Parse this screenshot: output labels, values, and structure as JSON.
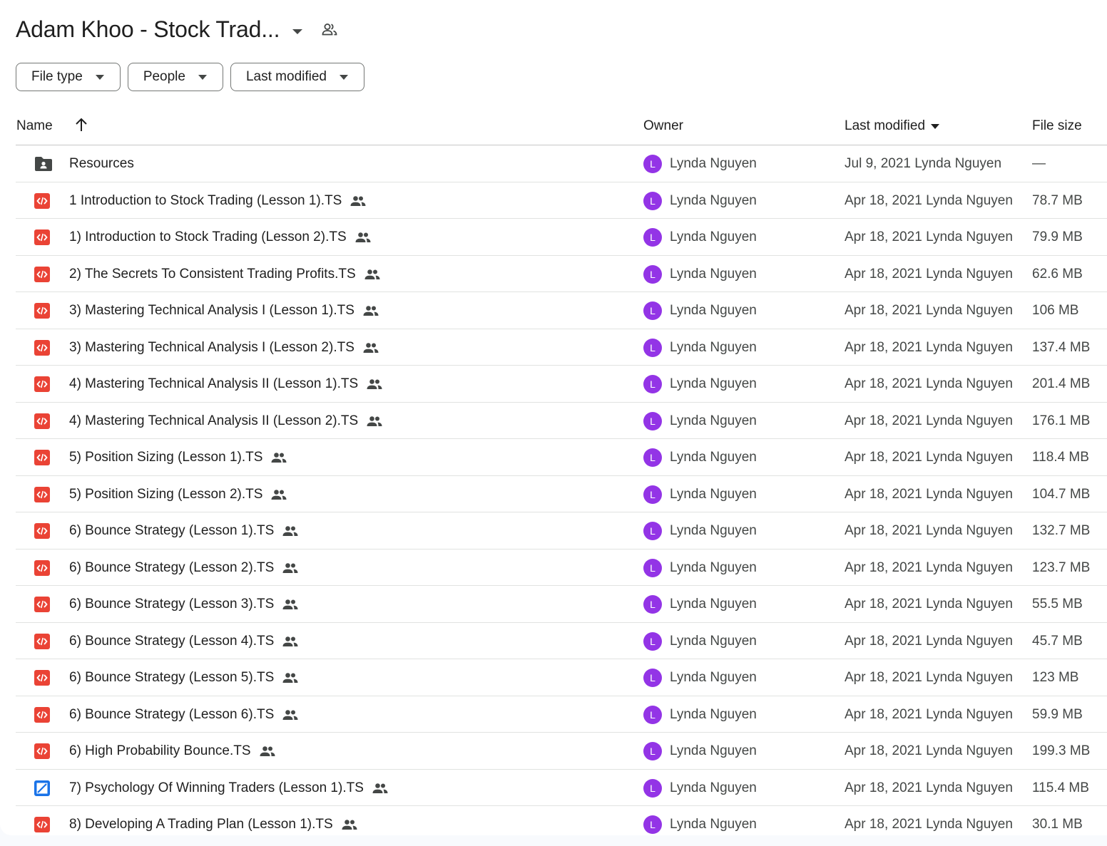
{
  "folder": {
    "title": "Adam Khoo - Stock Trad...",
    "caret_icon": "arrow-drop-down-icon",
    "share_icon": "people-outline-icon"
  },
  "filters": [
    {
      "label": "File type"
    },
    {
      "label": "People"
    },
    {
      "label": "Last modified"
    }
  ],
  "columns": {
    "name": "Name",
    "owner": "Owner",
    "last_modified": "Last modified",
    "file_size": "File size"
  },
  "colors": {
    "avatar": "#9334e6",
    "file_icon": "#ea4335",
    "folder_icon": "#444746",
    "video_icon": "#1a73e8"
  },
  "rows": [
    {
      "name": "Resources",
      "type": "folder",
      "shared": false,
      "owner_initial": "L",
      "owner": "Lynda Nguyen",
      "modified": "Jul 9, 2021 Lynda Nguyen",
      "size": "—"
    },
    {
      "name": "1 Introduction to Stock Trading (Lesson 1).TS",
      "type": "code",
      "shared": true,
      "owner_initial": "L",
      "owner": "Lynda Nguyen",
      "modified": "Apr 18, 2021 Lynda Nguyen",
      "size": "78.7 MB"
    },
    {
      "name": "1) Introduction to Stock Trading (Lesson 2).TS",
      "type": "code",
      "shared": true,
      "owner_initial": "L",
      "owner": "Lynda Nguyen",
      "modified": "Apr 18, 2021 Lynda Nguyen",
      "size": "79.9 MB"
    },
    {
      "name": "2) The Secrets To Consistent Trading Profits.TS",
      "type": "code",
      "shared": true,
      "owner_initial": "L",
      "owner": "Lynda Nguyen",
      "modified": "Apr 18, 2021 Lynda Nguyen",
      "size": "62.6 MB"
    },
    {
      "name": "3) Mastering Technical Analysis I (Lesson 1).TS",
      "type": "code",
      "shared": true,
      "owner_initial": "L",
      "owner": "Lynda Nguyen",
      "modified": "Apr 18, 2021 Lynda Nguyen",
      "size": "106 MB"
    },
    {
      "name": "3) Mastering Technical Analysis I (Lesson 2).TS",
      "type": "code",
      "shared": true,
      "owner_initial": "L",
      "owner": "Lynda Nguyen",
      "modified": "Apr 18, 2021 Lynda Nguyen",
      "size": "137.4 MB"
    },
    {
      "name": "4) Mastering Technical Analysis II (Lesson 1).TS",
      "type": "code",
      "shared": true,
      "owner_initial": "L",
      "owner": "Lynda Nguyen",
      "modified": "Apr 18, 2021 Lynda Nguyen",
      "size": "201.4 MB"
    },
    {
      "name": "4) Mastering Technical Analysis II (Lesson 2).TS",
      "type": "code",
      "shared": true,
      "owner_initial": "L",
      "owner": "Lynda Nguyen",
      "modified": "Apr 18, 2021 Lynda Nguyen",
      "size": "176.1 MB"
    },
    {
      "name": "5) Position Sizing (Lesson 1).TS",
      "type": "code",
      "shared": true,
      "owner_initial": "L",
      "owner": "Lynda Nguyen",
      "modified": "Apr 18, 2021 Lynda Nguyen",
      "size": "118.4 MB"
    },
    {
      "name": "5) Position Sizing (Lesson 2).TS",
      "type": "code",
      "shared": true,
      "owner_initial": "L",
      "owner": "Lynda Nguyen",
      "modified": "Apr 18, 2021 Lynda Nguyen",
      "size": "104.7 MB"
    },
    {
      "name": "6) Bounce Strategy (Lesson 1).TS",
      "type": "code",
      "shared": true,
      "owner_initial": "L",
      "owner": "Lynda Nguyen",
      "modified": "Apr 18, 2021 Lynda Nguyen",
      "size": "132.7 MB"
    },
    {
      "name": "6) Bounce Strategy (Lesson 2).TS",
      "type": "code",
      "shared": true,
      "owner_initial": "L",
      "owner": "Lynda Nguyen",
      "modified": "Apr 18, 2021 Lynda Nguyen",
      "size": "123.7 MB"
    },
    {
      "name": "6) Bounce Strategy (Lesson 3).TS",
      "type": "code",
      "shared": true,
      "owner_initial": "L",
      "owner": "Lynda Nguyen",
      "modified": "Apr 18, 2021 Lynda Nguyen",
      "size": "55.5 MB"
    },
    {
      "name": "6) Bounce Strategy (Lesson 4).TS",
      "type": "code",
      "shared": true,
      "owner_initial": "L",
      "owner": "Lynda Nguyen",
      "modified": "Apr 18, 2021 Lynda Nguyen",
      "size": "45.7 MB"
    },
    {
      "name": "6) Bounce Strategy (Lesson 5).TS",
      "type": "code",
      "shared": true,
      "owner_initial": "L",
      "owner": "Lynda Nguyen",
      "modified": "Apr 18, 2021 Lynda Nguyen",
      "size": "123 MB"
    },
    {
      "name": "6) Bounce Strategy (Lesson 6).TS",
      "type": "code",
      "shared": true,
      "owner_initial": "L",
      "owner": "Lynda Nguyen",
      "modified": "Apr 18, 2021 Lynda Nguyen",
      "size": "59.9 MB"
    },
    {
      "name": "6) High Probability Bounce.TS",
      "type": "code",
      "shared": true,
      "owner_initial": "L",
      "owner": "Lynda Nguyen",
      "modified": "Apr 18, 2021 Lynda Nguyen",
      "size": "199.3 MB"
    },
    {
      "name": "7) Psychology Of Winning Traders (Lesson 1).TS",
      "type": "video",
      "shared": true,
      "owner_initial": "L",
      "owner": "Lynda Nguyen",
      "modified": "Apr 18, 2021 Lynda Nguyen",
      "size": "115.4 MB"
    },
    {
      "name": "8) Developing A Trading Plan (Lesson 1).TS",
      "type": "code",
      "shared": true,
      "owner_initial": "L",
      "owner": "Lynda Nguyen",
      "modified": "Apr 18, 2021 Lynda Nguyen",
      "size": "30.1 MB"
    }
  ]
}
